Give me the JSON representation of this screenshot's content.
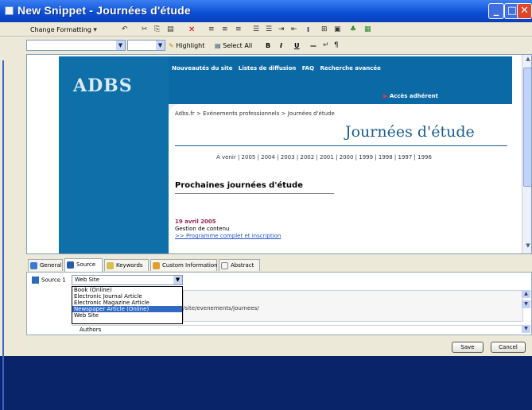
{
  "window": {
    "title": "New Snippet - Journées d'étude"
  },
  "toolbar1": {
    "change_formatting": "Change Formatting"
  },
  "toolbar2": {
    "highlight": "Highlight",
    "select_all": "Select All",
    "bold": "B",
    "italic": "I",
    "underline": "U"
  },
  "webpage": {
    "logo": "ADBS",
    "nav": [
      "Nouveautés du site",
      "Listes de diffusion",
      "FAQ",
      "Recherche avancée"
    ],
    "acces": "Accès adhérent",
    "breadcrumb": "Adbs.fr > Evénements professionnels > Journées d'étude",
    "title": "Journées d'étude",
    "years": "À venir | 2005 | 2004 | 2003 | 2002 | 2001 | 2000 | 1999 | 1998 | 1997 | 1996",
    "section": "Prochaines journées d'étude",
    "event_date": "19 avril 2005",
    "event_text": "Gestion de contenu",
    "event_link": ">> Programme complet et inscription"
  },
  "tabs": [
    "General",
    "Source",
    "Keywords",
    "Custom Information",
    "Abstract"
  ],
  "source": {
    "label": "Source 1",
    "selected": "Web Site",
    "options": [
      "Book (Online)",
      "Electronic Journal Article",
      "Electronic Magazine Article",
      "Newspaper Article (Online)",
      "Web Site"
    ],
    "url_fragment": "/site/evenements/journees/",
    "authors": "Authors"
  },
  "buttons": {
    "save": "Save",
    "cancel": "Cancel"
  }
}
